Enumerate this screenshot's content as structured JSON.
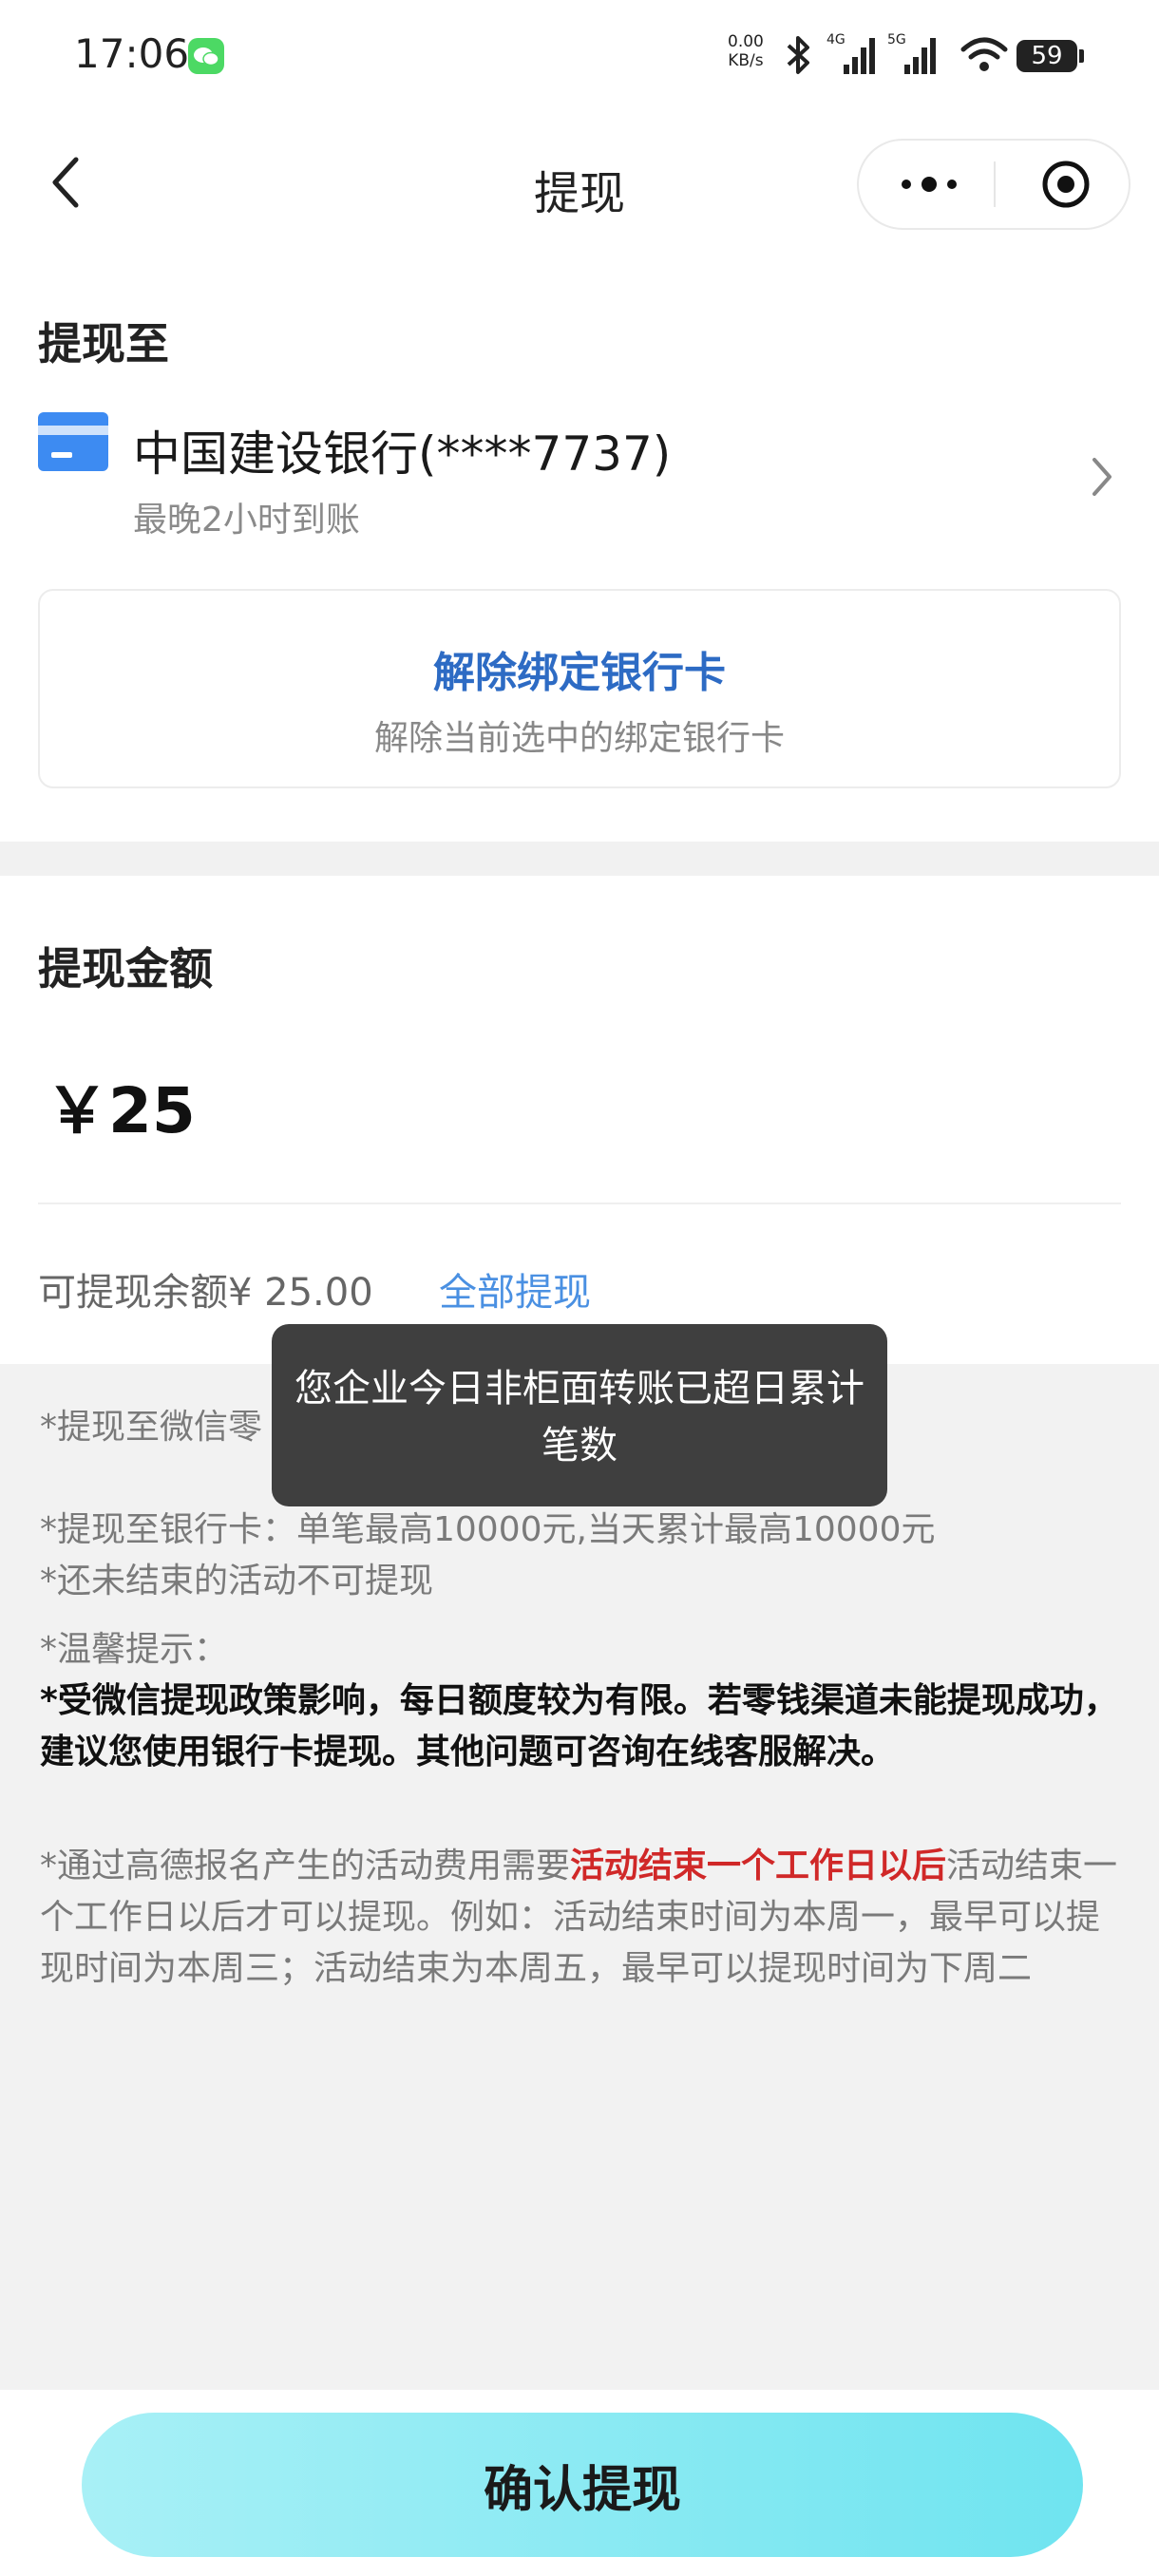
{
  "status_bar": {
    "time": "17:06",
    "net_speed_value": "0.00",
    "net_speed_unit": "KB/s",
    "signal_1_label": "4G",
    "signal_2_label": "5G",
    "battery": "59"
  },
  "nav": {
    "title": "提现"
  },
  "withdraw_to": {
    "title": "提现至",
    "bank_name": "中国建设银行(****7737)",
    "arrival_note": "最晚2小时到账",
    "unbind_title": "解除绑定银行卡",
    "unbind_desc": "解除当前选中的绑定银行卡"
  },
  "amount": {
    "title": "提现金额",
    "value": "￥25",
    "balance_label": "可提现余额¥ 25.00",
    "withdraw_all": "全部提现"
  },
  "notes": {
    "note_1": "*提现至微信零                                                   多提现10笔（如额度无法",
    "note_2": "*提现至银行卡：单笔最高10000元,当天累计最高10000元",
    "note_3": "*还未结束的活动不可提现",
    "tip_label": "*温馨提示：",
    "tip_bold": "*受微信提现政策影响，每日额度较为有限。若零钱渠道未能提现成功，建议您使用银行卡提现。其他问题可咨询在线客服解决。",
    "note_4_before": "*通过高德报名产生的活动费用需要",
    "note_4_highlight": "活动结束一个工作日以后",
    "note_4_after": "活动结束一个工作日以后才可以提现。例如：活动结束时间为本周一，最早可以提现时间为本周三；活动结束为本周五，最早可以提现时间为下周二"
  },
  "toast": {
    "message": "您企业今日非柜面转账已超日累计笔数"
  },
  "footer": {
    "confirm_label": "确认提现"
  },
  "colors": {
    "link_blue": "#4a90e2",
    "unbind_blue": "#2d6bc4",
    "highlight_red": "#d02828",
    "button_gradient_start": "#a8f0f6",
    "button_gradient_end": "#6fe4f0"
  }
}
